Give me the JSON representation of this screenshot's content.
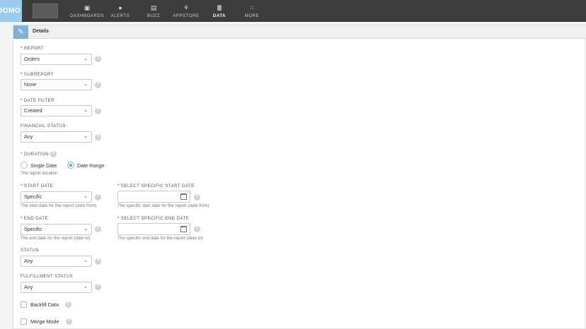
{
  "nav": {
    "logo": "DOMO",
    "items": [
      {
        "label": "DASHBOARDS",
        "icon": "dashboards-icon"
      },
      {
        "label": "ALERTS",
        "icon": "bell-icon"
      },
      {
        "label": "BUZZ",
        "icon": "chat-icon"
      },
      {
        "label": "APPSTORE",
        "icon": "appstore-icon"
      },
      {
        "label": "DATA",
        "icon": "database-icon"
      },
      {
        "label": "MORE",
        "icon": "grid-icon"
      }
    ],
    "active": "DATA"
  },
  "card": {
    "title": "Details"
  },
  "form": {
    "report": {
      "label": "* REPORT",
      "value": "Orders"
    },
    "subreport": {
      "label": "* SUBREPORT",
      "value": "None"
    },
    "date_filter": {
      "label": "* DATE FILTER",
      "value": "Created"
    },
    "financial_status": {
      "label": "FINANCIAL STATUS",
      "value": "Any"
    },
    "duration": {
      "label": "* DURATION",
      "options": [
        "Single Date",
        "Date Range"
      ],
      "selected": "Date Range",
      "hint": "The report duration"
    },
    "start_date": {
      "label": "* START DATE",
      "value": "Specific",
      "hint": "The start date for the report (date from)"
    },
    "specific_start": {
      "label": "* SELECT SPECIFIC START DATE",
      "value": "",
      "hint": "The specific start date for the report (date from)"
    },
    "end_date": {
      "label": "* END DATE",
      "value": "Specific",
      "hint": "The end date for the report (date to)"
    },
    "specific_end": {
      "label": "* SELECT SPECIFIC END DATE",
      "value": "",
      "hint": "The specific end date for the report (date to)"
    },
    "status": {
      "label": "STATUS",
      "value": "Any"
    },
    "fulfillment_status": {
      "label": "FULFILLMENT STATUS",
      "value": "Any"
    },
    "backfill": {
      "label": "Backfill Data",
      "checked": false
    },
    "merge": {
      "label": "Merge Mode",
      "checked": false
    }
  },
  "help_glyph": "?",
  "chevron_glyph": "⌄"
}
